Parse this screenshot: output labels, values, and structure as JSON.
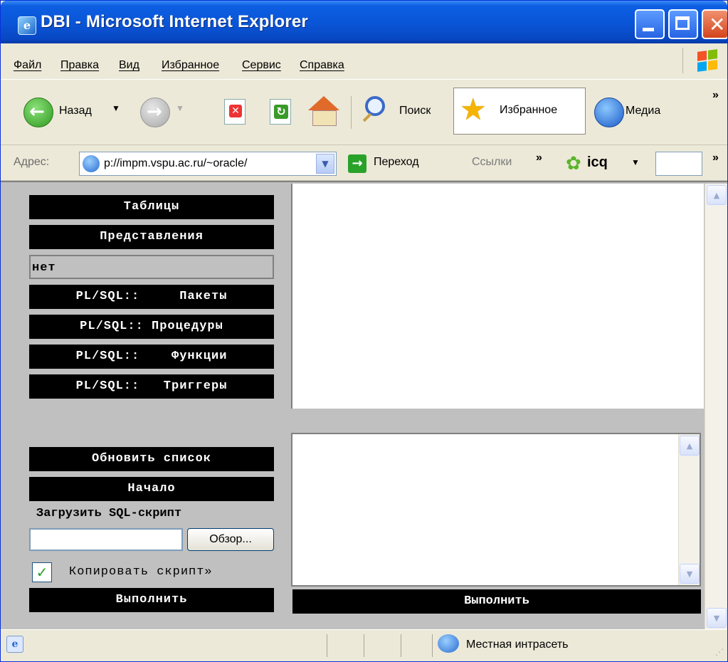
{
  "window": {
    "title": "DBI - Microsoft Internet Explorer"
  },
  "menu": [
    "Файл",
    "Правка",
    "Вид",
    "Избранное",
    "Сервис",
    "Справка"
  ],
  "toolbar": {
    "back": "Назад",
    "search": "Поиск",
    "favorites": "Избранное",
    "media": "Медиа",
    "more": "»"
  },
  "address": {
    "label": "Адрес:",
    "url": "p://impm.vspu.ac.ru/~oracle/",
    "go": "Переход",
    "links": "Ссылки",
    "links_more": "»",
    "icq": "icq",
    "more": "»"
  },
  "left_nav": {
    "tables": "Таблицы",
    "views": "Представления",
    "none": "нет",
    "packages": "PL/SQL::     Пакеты",
    "procedures": "PL/SQL:: Процедуры",
    "functions": "PL/SQL::    Функции",
    "triggers": "PL/SQL::   Триггеры",
    "refresh": "Обновить список",
    "home": "Начало",
    "load_script": "Загрузить SQL-скрипт",
    "browse": "Обзор...",
    "copy_script": "Копировать скрипт»",
    "copy_script_checked": true,
    "run": "Выполнить"
  },
  "main": {
    "run": "Выполнить",
    "sql_text": ""
  },
  "status": {
    "zone": "Местная интрасеть"
  }
}
